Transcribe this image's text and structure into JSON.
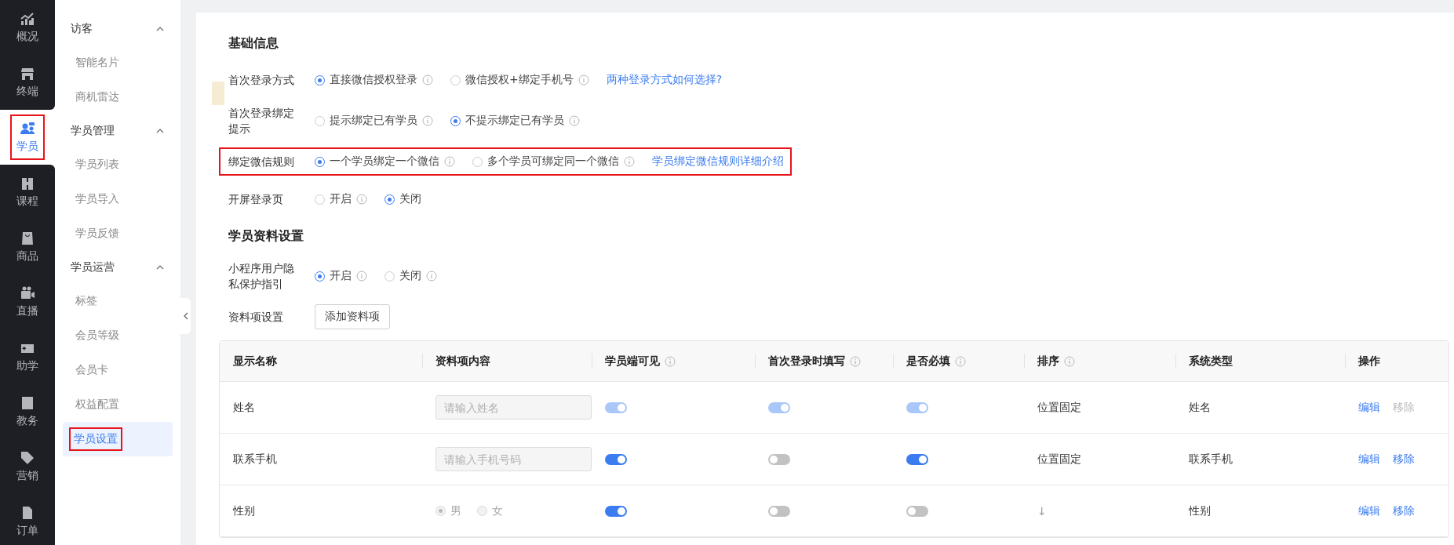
{
  "rail": [
    {
      "label": "概况",
      "selected": false,
      "highlighted": false
    },
    {
      "label": "终端",
      "selected": false,
      "highlighted": false
    },
    {
      "label": "学员",
      "selected": true,
      "highlighted": true
    },
    {
      "label": "课程",
      "selected": false,
      "highlighted": false
    },
    {
      "label": "商品",
      "selected": false,
      "highlighted": false
    },
    {
      "label": "直播",
      "selected": false,
      "highlighted": false
    },
    {
      "label": "助学",
      "selected": false,
      "highlighted": false
    },
    {
      "label": "教务",
      "selected": false,
      "highlighted": false
    },
    {
      "label": "营销",
      "selected": false,
      "highlighted": false
    },
    {
      "label": "订单",
      "selected": false,
      "highlighted": false
    }
  ],
  "submenu": [
    {
      "title": "访客",
      "expanded": true,
      "items": [
        {
          "label": "智能名片",
          "selected": false,
          "highlighted": false
        },
        {
          "label": "商机雷达",
          "selected": false,
          "highlighted": false
        }
      ]
    },
    {
      "title": "学员管理",
      "expanded": true,
      "items": [
        {
          "label": "学员列表",
          "selected": false,
          "highlighted": false
        },
        {
          "label": "学员导入",
          "selected": false,
          "highlighted": false
        },
        {
          "label": "学员反馈",
          "selected": false,
          "highlighted": false
        }
      ]
    },
    {
      "title": "学员运营",
      "expanded": true,
      "items": [
        {
          "label": "标签",
          "selected": false,
          "highlighted": false
        },
        {
          "label": "会员等级",
          "selected": false,
          "highlighted": false
        },
        {
          "label": "会员卡",
          "selected": false,
          "highlighted": false
        },
        {
          "label": "权益配置",
          "selected": false,
          "highlighted": false
        },
        {
          "label": "学员设置",
          "selected": true,
          "highlighted": true
        }
      ]
    }
  ],
  "basic": {
    "title": "基础信息",
    "rows": [
      {
        "label": "首次登录方式",
        "highlighted": false,
        "options": [
          {
            "label": "直接微信授权登录",
            "selected": true,
            "info": true
          },
          {
            "label": "微信授权+绑定手机号",
            "selected": false,
            "info": true
          }
        ],
        "link": "两种登录方式如何选择?"
      },
      {
        "label": "首次登录绑定提示",
        "highlighted": false,
        "options": [
          {
            "label": "提示绑定已有学员",
            "selected": false,
            "info": true
          },
          {
            "label": "不提示绑定已有学员",
            "selected": true,
            "info": true
          }
        ]
      },
      {
        "label": "绑定微信规则",
        "highlighted": true,
        "options": [
          {
            "label": "一个学员绑定一个微信",
            "selected": true,
            "info": true
          },
          {
            "label": "多个学员可绑定同一个微信",
            "selected": false,
            "info": true
          }
        ],
        "link": "学员绑定微信规则详细介绍"
      },
      {
        "label": "开屏登录页",
        "highlighted": false,
        "options": [
          {
            "label": "开启",
            "selected": false,
            "info": true
          },
          {
            "label": "关闭",
            "selected": true,
            "info": false
          }
        ]
      }
    ]
  },
  "profile": {
    "title": "学员资料设置",
    "rows": [
      {
        "label": "小程序用户隐私保护指引",
        "highlighted": false,
        "options": [
          {
            "label": "开启",
            "selected": true,
            "info": true
          },
          {
            "label": "关闭",
            "selected": false,
            "info": true
          }
        ]
      }
    ],
    "items_label": "资料项设置",
    "add_button": "添加资料项"
  },
  "table": {
    "columns": [
      {
        "label": "显示名称",
        "info": false
      },
      {
        "label": "资料项内容",
        "info": false
      },
      {
        "label": "学员端可见",
        "info": true
      },
      {
        "label": "首次登录时填写",
        "info": true
      },
      {
        "label": "是否必填",
        "info": true
      },
      {
        "label": "排序",
        "info": true
      },
      {
        "label": "系统类型",
        "info": false
      },
      {
        "label": "操作",
        "info": false
      }
    ],
    "rows": [
      {
        "name": "姓名",
        "content": {
          "kind": "input",
          "placeholder": "请输入姓名",
          "disabled": true
        },
        "visible": {
          "on": true,
          "disabled": true
        },
        "first_login": {
          "on": true,
          "disabled": true
        },
        "required": {
          "on": true,
          "disabled": true
        },
        "sort": {
          "kind": "text",
          "label": "位置固定"
        },
        "type": "姓名",
        "actions": [
          {
            "label": "编辑",
            "disabled": false
          },
          {
            "label": "移除",
            "disabled": true
          }
        ]
      },
      {
        "name": "联系手机",
        "content": {
          "kind": "input",
          "placeholder": "请输入手机号码",
          "disabled": true
        },
        "visible": {
          "on": true,
          "disabled": false
        },
        "first_login": {
          "on": false,
          "disabled": false
        },
        "required": {
          "on": true,
          "disabled": false
        },
        "sort": {
          "kind": "text",
          "label": "位置固定"
        },
        "type": "联系手机",
        "actions": [
          {
            "label": "编辑",
            "disabled": false
          },
          {
            "label": "移除",
            "disabled": false
          }
        ]
      },
      {
        "name": "性别",
        "content": {
          "kind": "radio",
          "disabled": true,
          "options": [
            {
              "label": "男",
              "selected": true
            },
            {
              "label": "女",
              "selected": false
            }
          ]
        },
        "visible": {
          "on": true,
          "disabled": false
        },
        "first_login": {
          "on": false,
          "disabled": false
        },
        "required": {
          "on": false,
          "disabled": false
        },
        "sort": {
          "kind": "drag",
          "label": "↓"
        },
        "type": "性别",
        "actions": [
          {
            "label": "编辑",
            "disabled": false
          },
          {
            "label": "移除",
            "disabled": false
          }
        ]
      }
    ]
  }
}
